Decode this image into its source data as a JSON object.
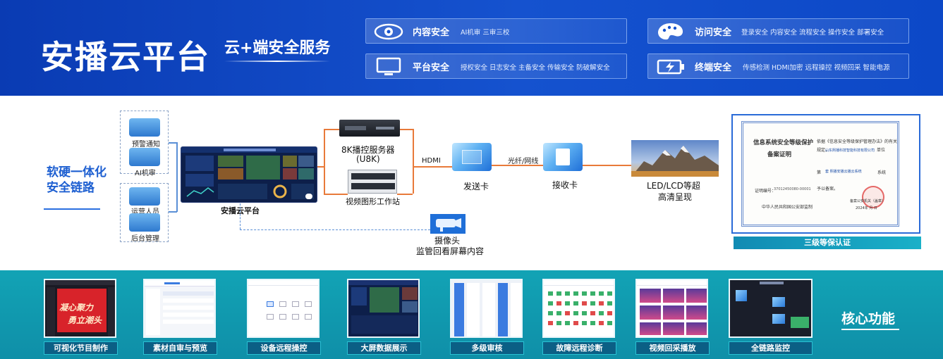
{
  "header": {
    "title": "安播云平台",
    "subtitle": "云+端安全服务",
    "features": [
      {
        "icon": "eye-icon",
        "title": "内容安全",
        "desc": "AI机审  三审三校"
      },
      {
        "icon": "monitor-icon",
        "title": "平台安全",
        "desc": "授权安全 日志安全  主备安全  传输安全  防破解安全"
      },
      {
        "icon": "palette-icon",
        "title": "访问安全",
        "desc": "登录安全  内容安全  流程安全  操作安全 部署安全"
      },
      {
        "icon": "battery-icon",
        "title": "终端安全",
        "desc": "传感检测  HDMI加密  远程操控  视频回采  智能电源"
      }
    ]
  },
  "diagram": {
    "side_title_line1": "软硬一体化",
    "side_title_line2": "安全链路",
    "inputs": [
      "预警通知",
      "AI机审",
      "运营人员",
      "后台管理"
    ],
    "platform_label": "安播云平台",
    "server_label_line1": "8K播控服务器",
    "server_label_line2": "(U8K)",
    "workstation_label": "视频图形工作站",
    "hdmi_label": "HDMI",
    "sender_label": "发送卡",
    "fiber_label": "光纤/网线",
    "receiver_label": "接收卡",
    "display_label_line1": "LED/LCD等超",
    "display_label_line2": "高清呈现",
    "camera_label_line1": "摄像头",
    "camera_label_line2": "监管回看屏幕内容"
  },
  "certificate": {
    "title_line1": "信息系统安全等级保护",
    "title_line2": "备案证明",
    "right_line1": "依据《信息安全等级保护管理办法》的有关",
    "right_line2": "规定，",
    "company": "山东熙播科技智能科技有限公司",
    "unit_suffix": "单位",
    "system_prefix": "第",
    "system_name": "套 熙播安播云播云系统",
    "system_suffix": "系统",
    "grant": "予以备案。",
    "cert_no_label": "证明编号：",
    "cert_no": "37012450080-00001",
    "authority": "中华人民共和国公安部监制",
    "issuer": "备案公安机关（盖章）",
    "date": "2024年  月  日",
    "badge": "三级等保认证"
  },
  "bottom": {
    "core_title": "核心功能",
    "thumb1_text_a": "凝心聚力",
    "thumb1_text_b": "勇立潮头",
    "items": [
      "可视化节目制作",
      "素材自审与预览",
      "设备远程操控",
      "大屏数据展示",
      "多级审核",
      "故障远程诊断",
      "视频回采播放",
      "全链路监控"
    ]
  },
  "colors": {
    "header_blue": "#1552cf",
    "accent_blue": "#1d5fd1",
    "connector_orange": "#e87a3a",
    "bottom_teal": "#12a3b5",
    "badge_dark": "#0b5f85"
  }
}
